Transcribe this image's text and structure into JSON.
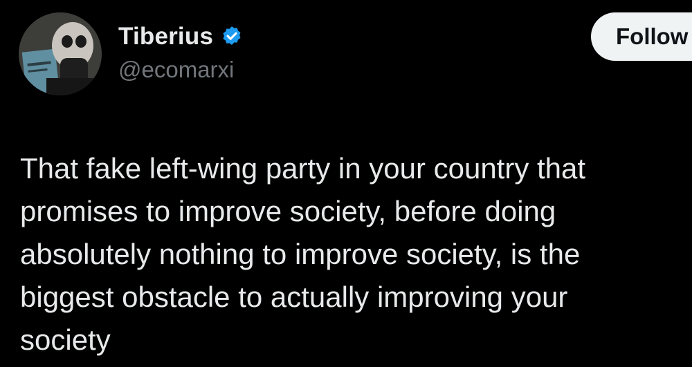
{
  "author": {
    "display_name": "Tiberius",
    "handle": "@ecomarxi",
    "verified_icon": "verified-badge-icon",
    "avatar_icon": "avatar-image"
  },
  "actions": {
    "follow_label": "Follow"
  },
  "tweet": {
    "lines": [
      "That fake left-wing party in your country that",
      "promises to improve society, before doing",
      "absolutely nothing to improve society, is the",
      "biggest obstacle to actually improving your",
      "society"
    ]
  },
  "colors": {
    "background": "#000000",
    "primary_text": "#e7e9ea",
    "secondary_text": "#71767b",
    "verified_blue": "#1d9bf0",
    "follow_bg": "#eff3f4",
    "follow_text": "#0f1419"
  }
}
